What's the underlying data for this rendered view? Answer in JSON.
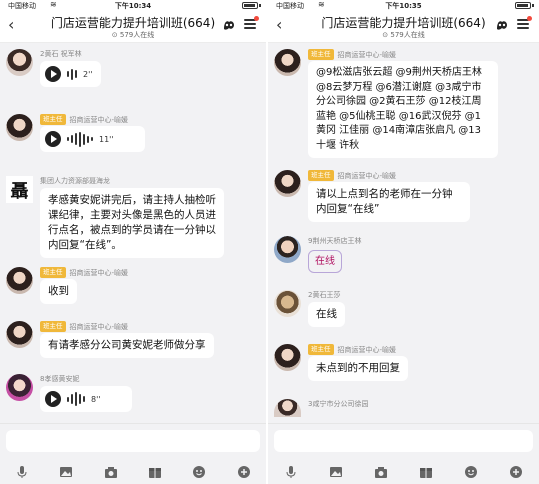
{
  "app": {
    "status_bar": {
      "carrier": "中国移动",
      "left_time": "下午10:34",
      "right_time": "下午10:35"
    },
    "group": {
      "title": "门店运营能力提升培训班(664)",
      "online": "579人在线"
    },
    "icons": {
      "back": "chevron-left-icon",
      "brand": "app-logo-icon",
      "menu": "hamburger-menu-icon",
      "voice_play": "play-icon",
      "toolbar": [
        "microphone-icon",
        "image-icon",
        "camera-icon",
        "gift-icon",
        "emoji-icon",
        "plus-icon"
      ]
    },
    "colors": {
      "background": "#f2f2f4",
      "bubble": "#ffffff",
      "badge": "#f0b83a",
      "notify_dot": "#f24a3d"
    }
  },
  "left_chat": {
    "messages": [
      {
        "sender": "2黄石 祝军林",
        "type": "voice",
        "duration": "2''"
      },
      {
        "badge": "班主任",
        "sender": "招商运营中心-喻媛",
        "type": "voice",
        "duration": "11''"
      },
      {
        "sender": "集团人力资源部聂海龙",
        "avatar_text": "聶",
        "type": "text",
        "text": "孝感黄安妮讲完后，请主持人抽检听课纪律，主要对头像是黑色的人员进行点名，被点到的学员请在一分钟以内回复“在线”。"
      },
      {
        "badge": "班主任",
        "sender": "招商运营中心-喻媛",
        "type": "text",
        "text": "收到"
      },
      {
        "badge": "班主任",
        "sender": "招商运营中心-喻媛",
        "type": "text",
        "text": "有请孝感分公司黄安妮老师做分享"
      },
      {
        "sender": "8孝感黄安妮",
        "type": "voice",
        "duration": "8''"
      }
    ]
  },
  "right_chat": {
    "messages": [
      {
        "badge": "班主任",
        "sender": "招商运营中心-喻媛",
        "type": "text",
        "text": "@9松滋店张云超 @9荆州天桥店王林 @8云梦万程 @6潜江谢庭 @3咸宁市分公司徐园 @2黄石王莎 @12枝江周蓝艳 @5仙桃王聪 @16武汉倪芬 @1黄冈 江佳丽 @14南漳店张启凡 @13十堰 许秋"
      },
      {
        "badge": "班主任",
        "sender": "招商运营中心-喻媛",
        "type": "text",
        "text": "请以上点到名的老师在一分钟内回复“在线”"
      },
      {
        "sender": "9荆州天桥店王林",
        "type": "text",
        "text": "在线"
      },
      {
        "sender": "2黄石王莎",
        "type": "text",
        "text": "在线"
      },
      {
        "badge": "班主任",
        "sender": "招商运营中心-喻媛",
        "type": "text",
        "text": "未点到的不用回复"
      },
      {
        "sender": "3咸宁市分公司徐园",
        "type": "partial"
      }
    ]
  }
}
